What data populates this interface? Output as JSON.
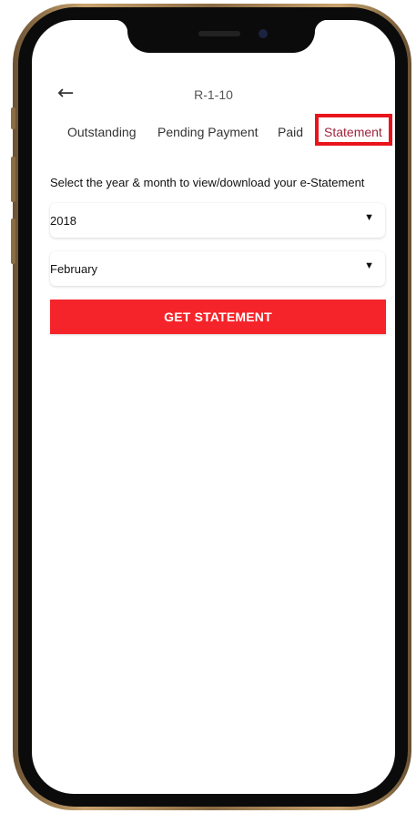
{
  "header": {
    "back_icon": "arrow-left-icon",
    "title": "R-1-10"
  },
  "tabs": [
    {
      "label": "Outstanding",
      "active": false
    },
    {
      "label": "Pending Payment",
      "active": false
    },
    {
      "label": "Paid",
      "active": false
    },
    {
      "label": "Statement",
      "active": true
    }
  ],
  "statement": {
    "instruction": "Select the year & month to view/download your e-Statement",
    "year_value": "2018",
    "month_value": "February",
    "button_label": "GET STATEMENT"
  },
  "colors": {
    "button": "#f5242a",
    "active_tab_text": "#a0243c",
    "highlight_border": "#e8141c"
  }
}
